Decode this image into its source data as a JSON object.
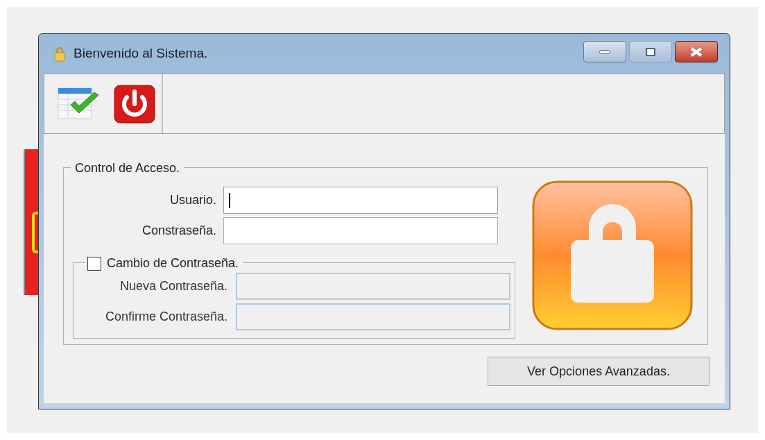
{
  "window": {
    "title": "Bienvenido al Sistema."
  },
  "toolbar": [
    {
      "kind": "accept"
    },
    {
      "kind": "power"
    }
  ],
  "access_group": {
    "title": "Control de Acceso.",
    "fields": [
      {
        "label": "Usuario.",
        "focused": true
      },
      {
        "label": "Constraseña.",
        "focused": false
      }
    ],
    "change_password": {
      "label": "Cambio de Contraseña.",
      "checked": false,
      "fields": [
        {
          "label": "Nueva Contraseña.",
          "disabled": true
        },
        {
          "label": "Confirme Contraseña.",
          "disabled": true
        }
      ]
    }
  },
  "advanced_button": "Ver Opciones Avanzadas."
}
